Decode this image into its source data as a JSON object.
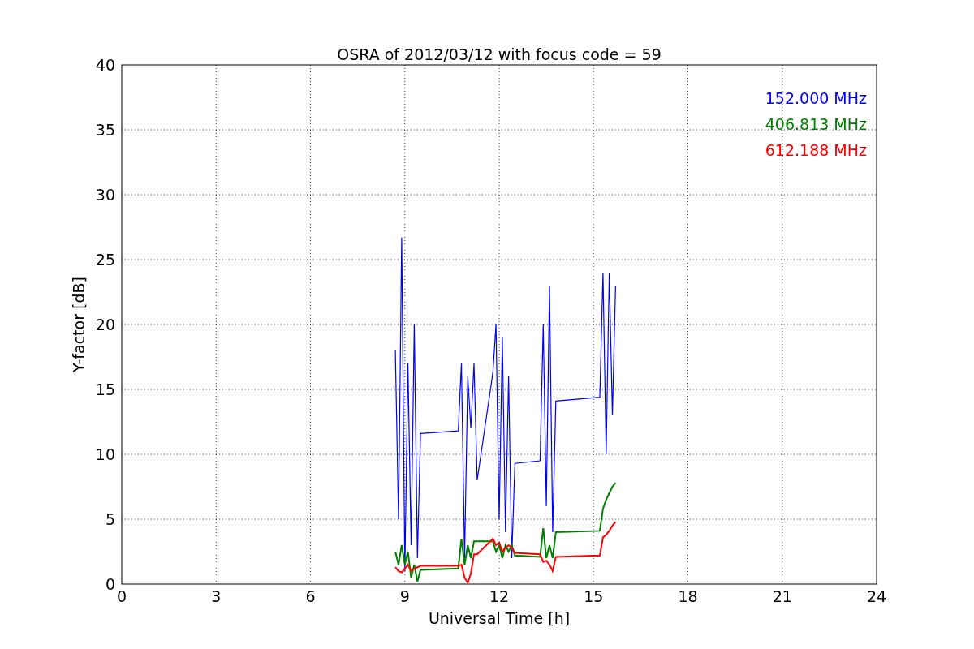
{
  "chart_data": {
    "type": "line",
    "title": "OSRA of 2012/03/12 with focus code = 59",
    "xlabel": "Universal Time [h]",
    "ylabel": "Y-factor [dB]",
    "x": [
      8.7,
      8.8,
      8.9,
      9.0,
      9.1,
      9.2,
      9.3,
      9.4,
      9.5,
      10.7,
      10.8,
      10.9,
      11.0,
      11.1,
      11.2,
      11.3,
      11.8,
      11.9,
      12.0,
      12.1,
      12.2,
      12.3,
      12.4,
      12.5,
      13.3,
      13.4,
      13.5,
      13.6,
      13.7,
      13.8,
      15.2,
      15.3,
      15.4,
      15.5,
      15.6,
      15.7
    ],
    "series": [
      {
        "name": "152.000 MHz",
        "color": "#0000ff",
        "values": [
          18,
          5,
          26.7,
          1,
          17,
          3,
          20,
          2,
          11.6,
          11.8,
          17,
          2,
          16,
          12,
          17,
          8,
          16.3,
          20,
          5,
          19,
          4,
          16,
          2,
          9.3,
          9.5,
          20,
          6,
          23,
          4,
          14.1,
          14.4,
          24,
          10,
          24,
          13,
          23
        ]
      },
      {
        "name": "406.813 MHz",
        "color": "#008000",
        "values": [
          2.5,
          1.5,
          3,
          1.5,
          2.5,
          0.5,
          1.5,
          0.2,
          1.1,
          1.2,
          3.5,
          1.5,
          3,
          2,
          3.3,
          3.3,
          3.3,
          2.5,
          3,
          2,
          3,
          2.5,
          3,
          2.2,
          2.1,
          4.3,
          2,
          3,
          2,
          4,
          4.1,
          5.8,
          6.5,
          7,
          7.5,
          7.8
        ]
      },
      {
        "name": "612.188 MHz",
        "color": "#ff0000",
        "values": [
          1.3,
          1,
          0.9,
          1.2,
          1.5,
          1,
          1.2,
          1.3,
          1.4,
          1.4,
          1.5,
          0.5,
          0.1,
          0.8,
          2.3,
          2.3,
          3.5,
          3,
          3.2,
          2.5,
          2.8,
          3,
          2.8,
          2.4,
          2.3,
          1.7,
          1.8,
          1.5,
          1,
          2.1,
          2.2,
          3.6,
          3.8,
          4.1,
          4.5,
          4.8
        ]
      }
    ],
    "xlim": [
      0,
      24
    ],
    "ylim": [
      0,
      40
    ],
    "xticks": [
      0,
      3,
      6,
      9,
      12,
      15,
      18,
      21,
      24
    ],
    "yticks": [
      0,
      5,
      10,
      15,
      20,
      25,
      30,
      35,
      40
    ],
    "grid": true
  }
}
